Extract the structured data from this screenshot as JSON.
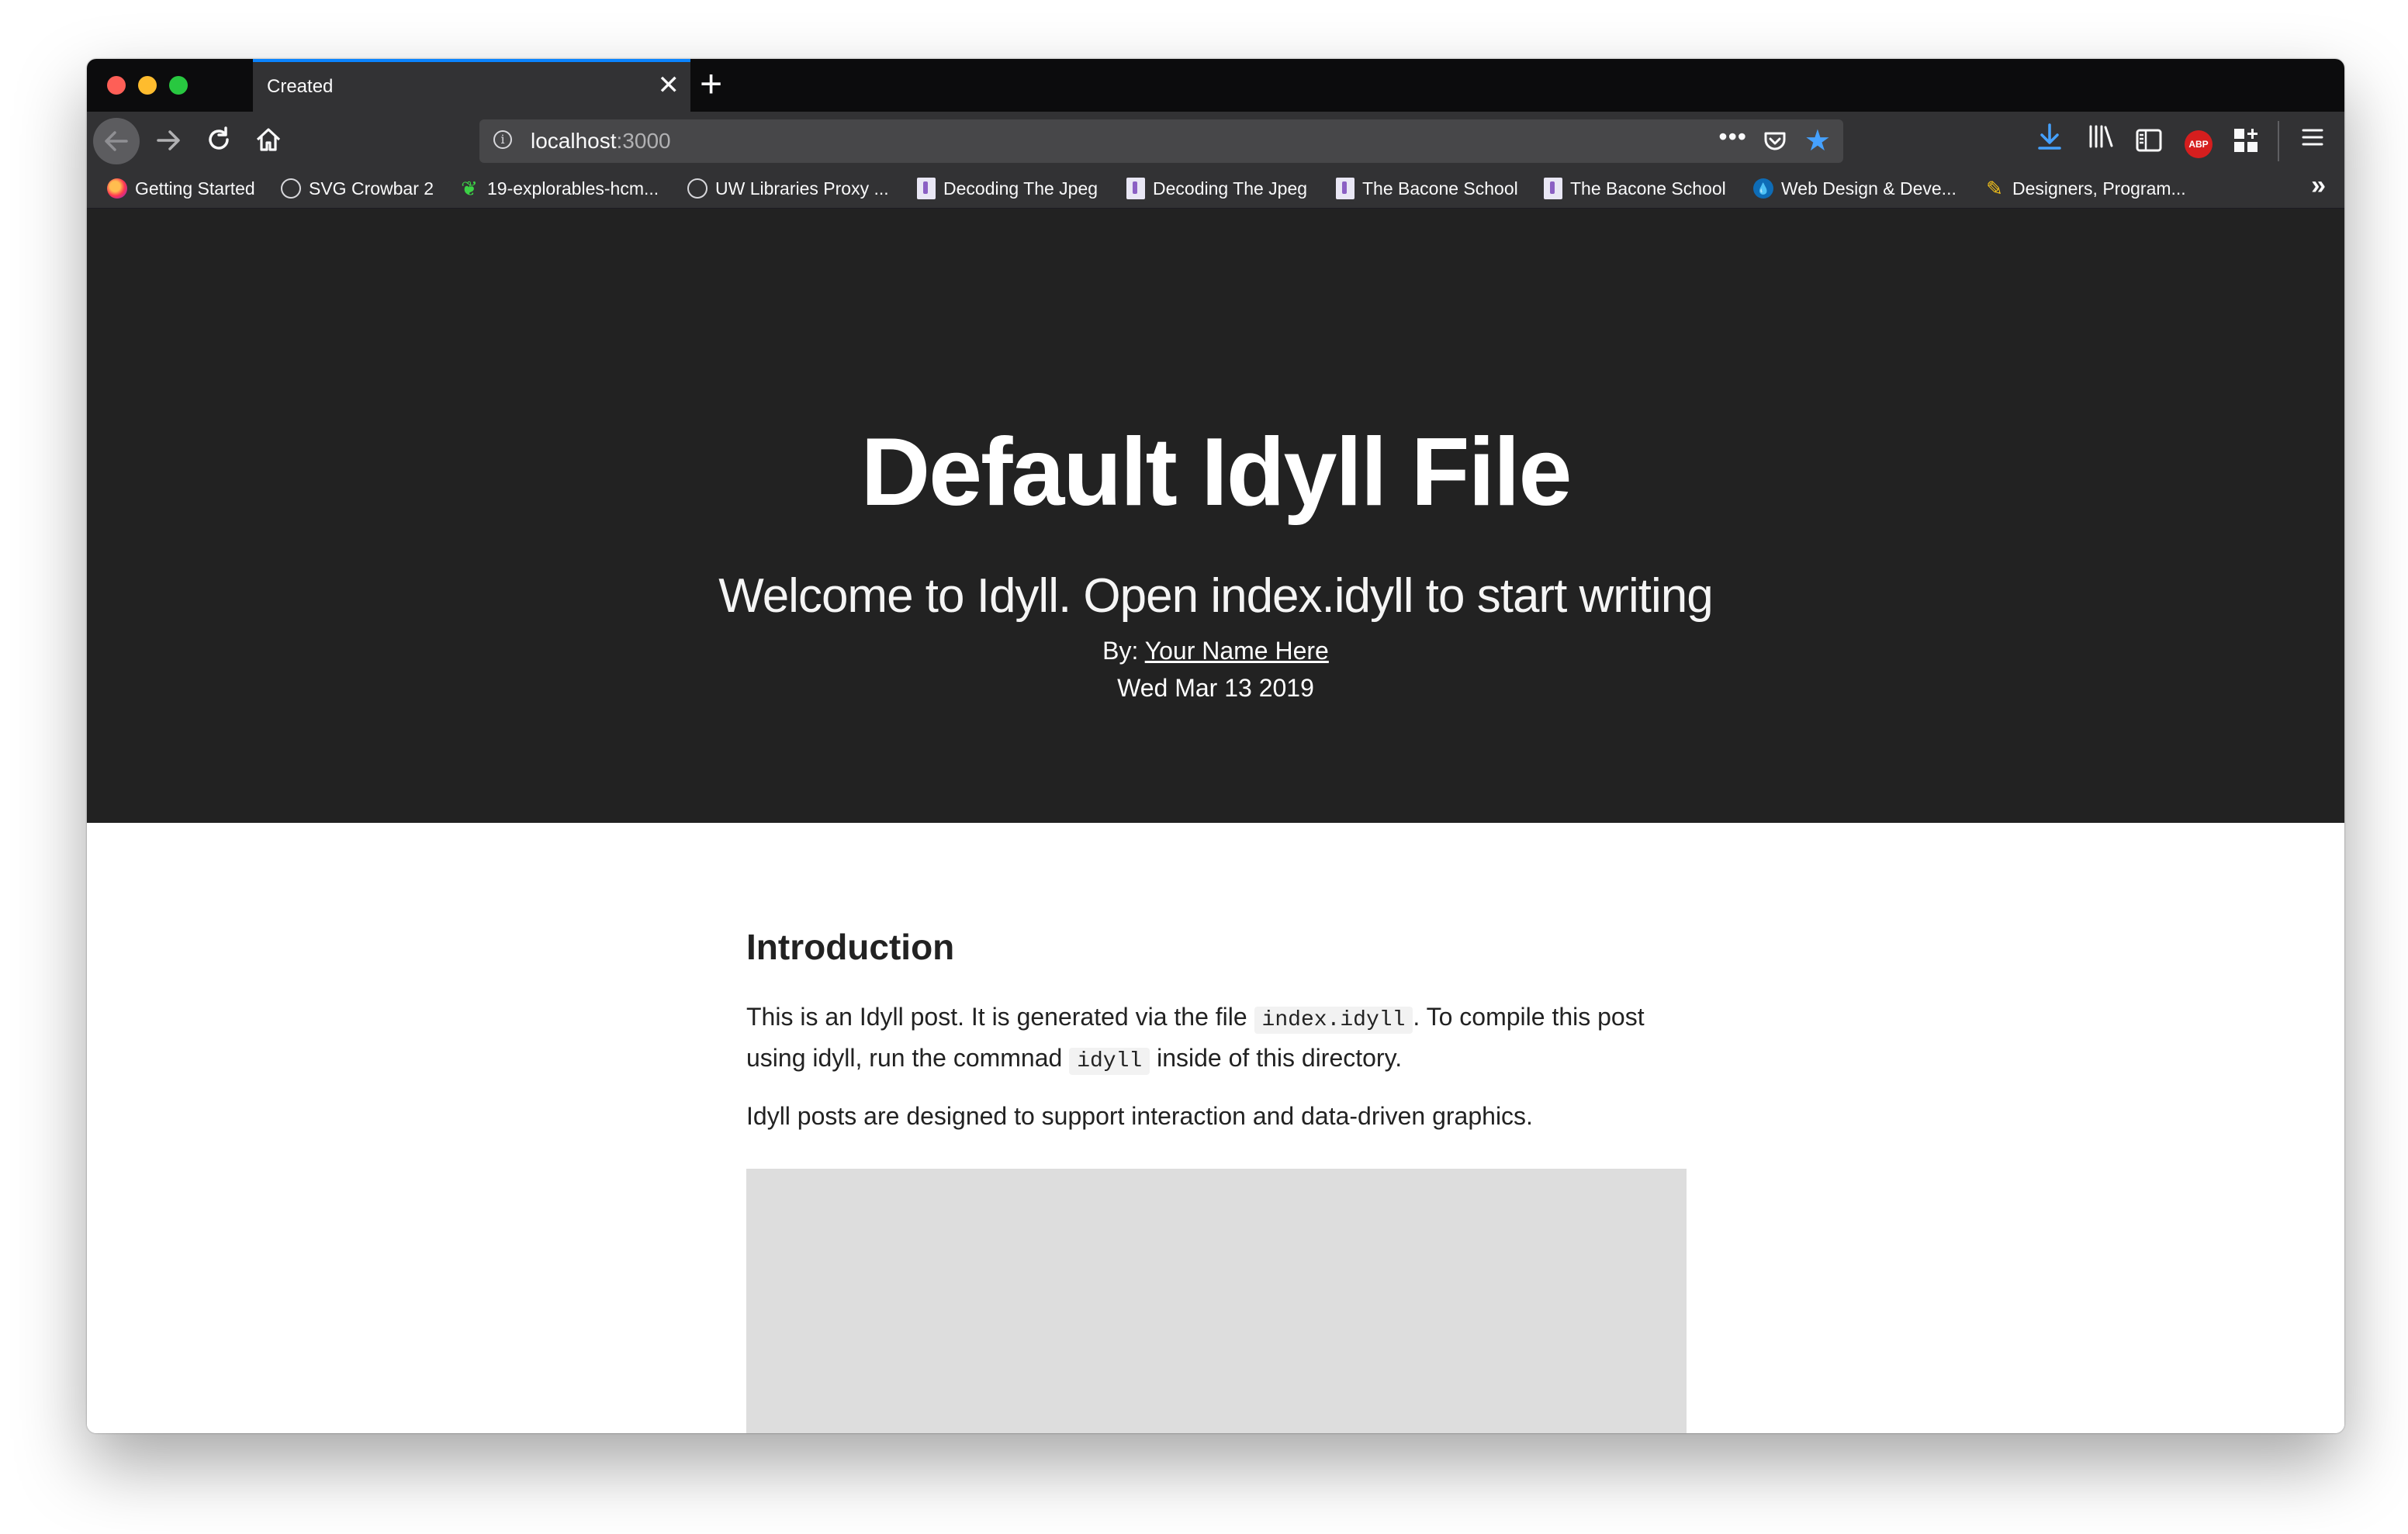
{
  "browser": {
    "tab_title": "Created",
    "tab_close": "✕",
    "new_tab": "+",
    "url_host": "localhost",
    "url_port": ":3000",
    "url_more": "•••"
  },
  "bookmarks": [
    {
      "label": "Getting Started",
      "icon": "firefox-icon"
    },
    {
      "label": "SVG Crowbar 2",
      "icon": "globe-icon"
    },
    {
      "label": "19-explorables-hcm...",
      "icon": "leaf-icon"
    },
    {
      "label": "UW Libraries Proxy ...",
      "icon": "globe-icon"
    },
    {
      "label": "Decoding The Jpeg",
      "icon": "page-icon"
    },
    {
      "label": "Decoding The Jpeg",
      "icon": "page-icon"
    },
    {
      "label": "The Bacone School",
      "icon": "page-icon"
    },
    {
      "label": "The Bacone School",
      "icon": "page-icon"
    },
    {
      "label": "Web Design & Deve...",
      "icon": "drop-icon"
    },
    {
      "label": "Designers, Program...",
      "icon": "pencil-icon"
    }
  ],
  "hero": {
    "title": "Default Idyll File",
    "subtitle": "Welcome to Idyll. Open index.idyll to start writing",
    "by_prefix": "By: ",
    "author": "Your Name Here",
    "date": "Wed Mar 13 2019"
  },
  "article": {
    "heading": "Introduction",
    "p1_a": "This is an Idyll post. It is generated via the file ",
    "p1_code1": "index.idyll",
    "p1_b": ". To compile this post using idyll, run the commnad ",
    "p1_code2": "idyll",
    "p1_c": " inside of this directory.",
    "p2": "Idyll posts are designed to support interaction and data-driven graphics."
  },
  "colors": {
    "hero_bg": "#222222",
    "tab_accent": "#0a84ff",
    "graphic_bg": "#dddddd"
  }
}
